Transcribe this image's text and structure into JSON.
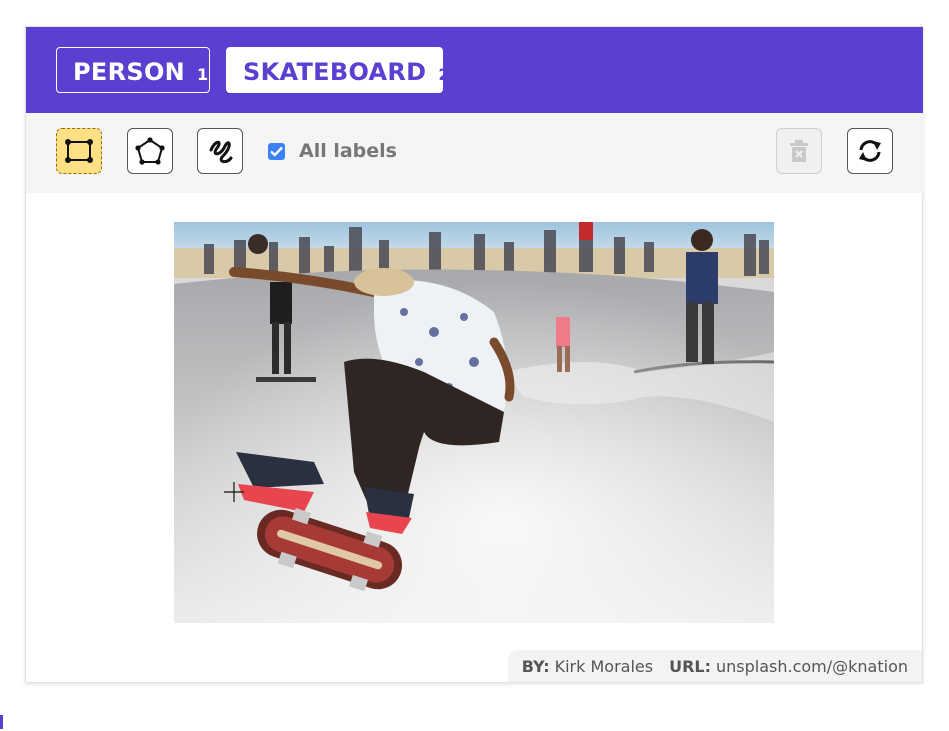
{
  "labels": [
    {
      "name": "PERSON",
      "key": "1"
    },
    {
      "name": "SKATEBOARD",
      "key": "2"
    }
  ],
  "toolbar": {
    "tools": [
      {
        "icon": "bounding-box-icon",
        "active": true
      },
      {
        "icon": "polygon-icon",
        "active": false
      },
      {
        "icon": "freehand-icon",
        "active": false
      }
    ],
    "all_labels_text": "All labels",
    "all_labels_checked": true,
    "delete_icon": "delete-icon",
    "reset_icon": "reset-icon"
  },
  "credits": {
    "by_label": "BY:",
    "by_value": "Kirk Morales",
    "url_label": "URL:",
    "url_value": "unsplash.com/@knation"
  },
  "colors": {
    "header": "#5a3fd0",
    "active_tool": "#ffe085",
    "checkbox": "#3b82f6"
  }
}
